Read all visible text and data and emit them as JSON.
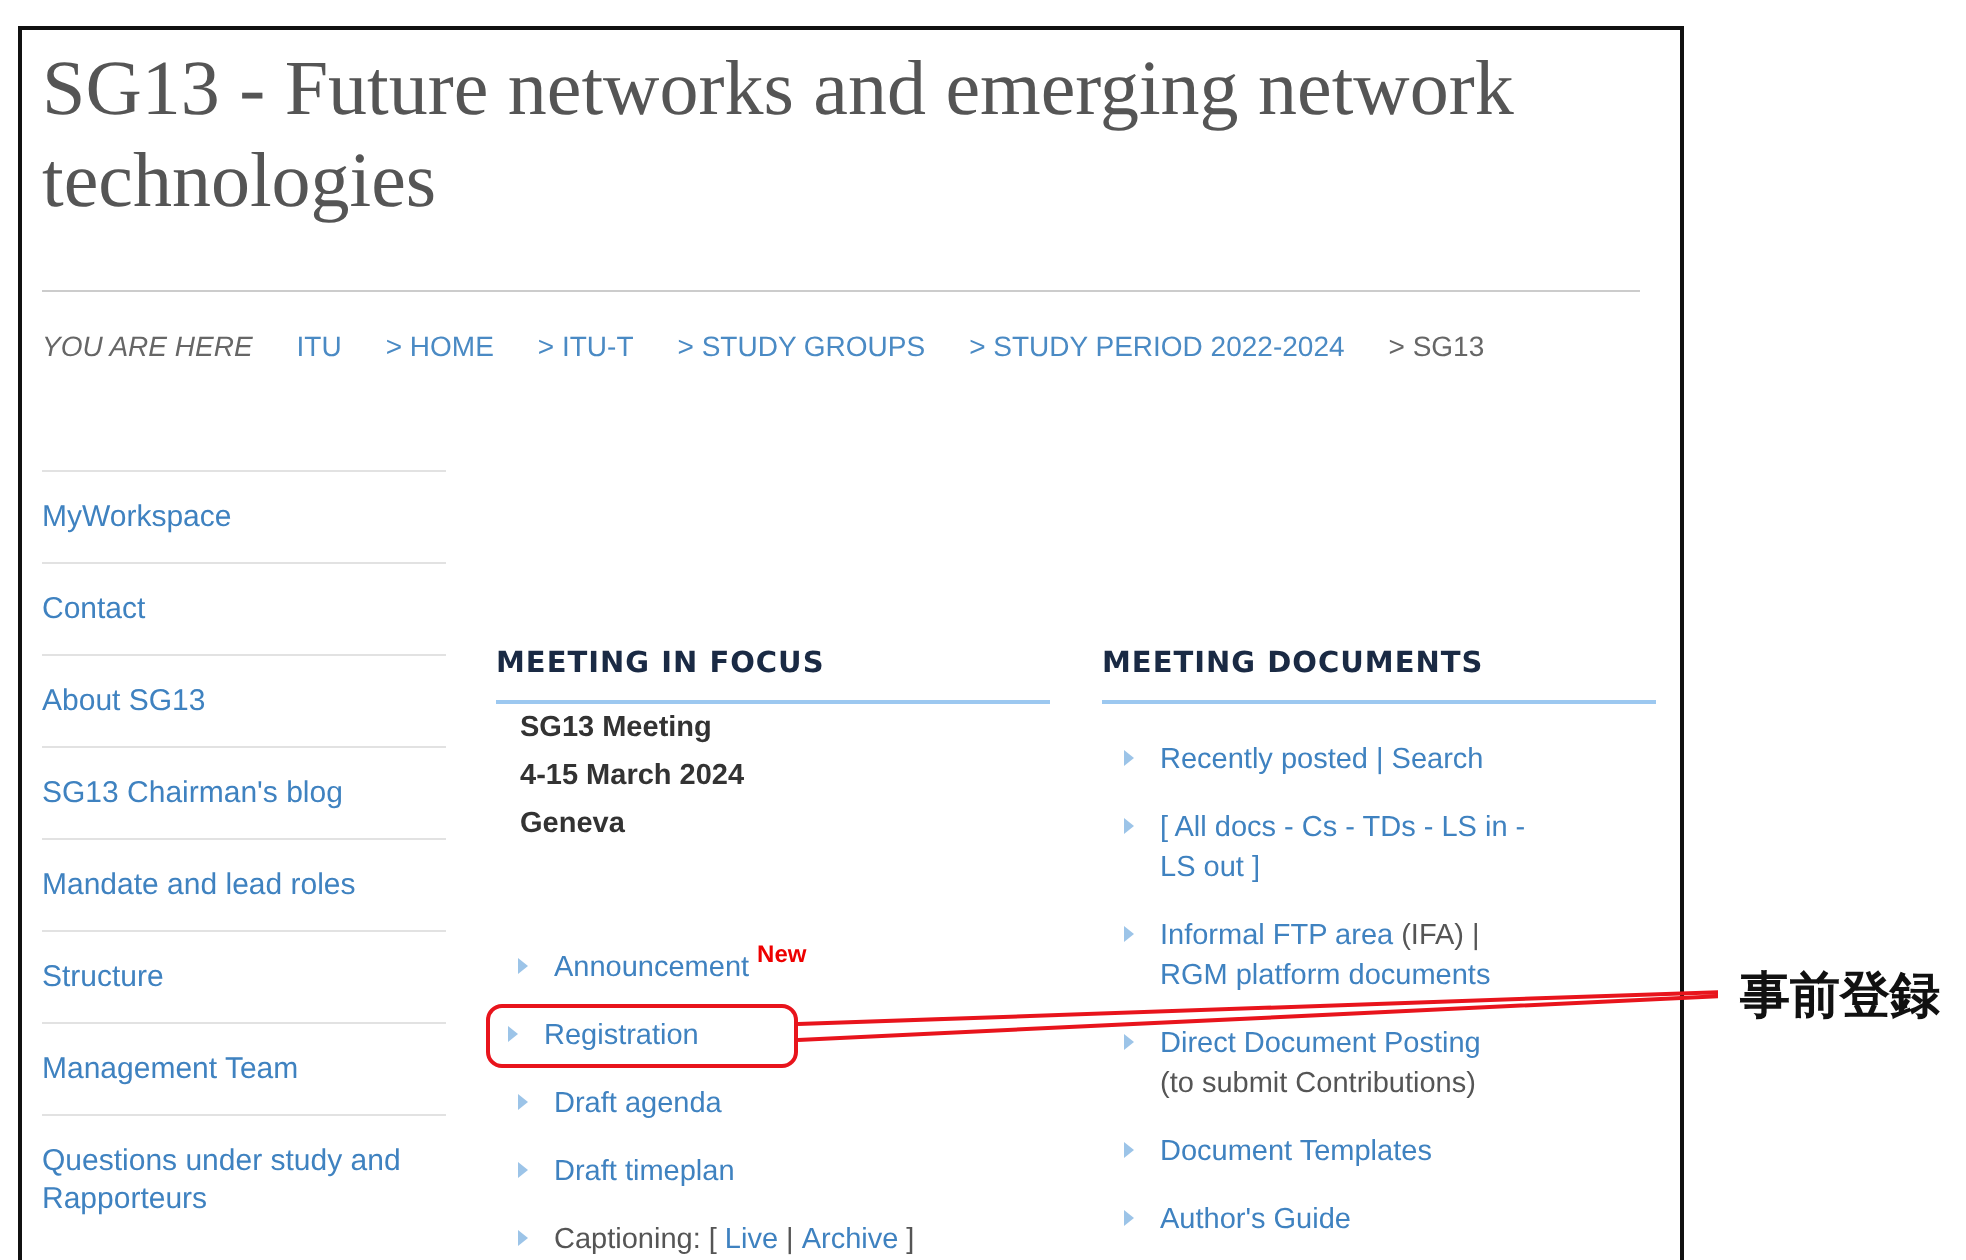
{
  "title": "SG13 - Future networks and emerging network technologies",
  "breadcrumb": {
    "label": "YOU ARE HERE",
    "items": [
      {
        "text": "ITU",
        "current": false
      },
      {
        "text": "> HOME",
        "current": false
      },
      {
        "text": "> ITU-T",
        "current": false
      },
      {
        "text": "> STUDY GROUPS",
        "current": false
      },
      {
        "text": "> STUDY PERIOD 2022-2024",
        "current": false
      },
      {
        "text": "> SG13",
        "current": true
      }
    ]
  },
  "sidebar": {
    "items": [
      "MyWorkspace",
      "Contact",
      "About SG13",
      "SG13 Chairman's blog",
      "Mandate and lead roles",
      "Structure",
      "Management Team",
      "Questions under study and Rapporteurs"
    ]
  },
  "meeting_in_focus": {
    "heading": "MEETING IN FOCUS",
    "meeting": [
      "SG13 Meeting",
      "4-15 March 2024",
      "Geneva"
    ],
    "links": [
      {
        "lines": [
          [
            {
              "text": "Announcement",
              "link": true
            }
          ]
        ],
        "badge": "New",
        "highlighted": false
      },
      {
        "lines": [
          [
            {
              "text": "Registration",
              "link": true
            }
          ]
        ],
        "highlighted": true
      },
      {
        "lines": [
          [
            {
              "text": "Draft agenda",
              "link": true
            }
          ]
        ],
        "highlighted": false
      },
      {
        "lines": [
          [
            {
              "text": "Draft timeplan",
              "link": true
            }
          ]
        ],
        "highlighted": false
      },
      {
        "lines": [
          [
            {
              "text": "Captioning: [",
              "link": false
            },
            {
              "text": "Live",
              "link": true
            },
            {
              "text": "|",
              "link": false
            },
            {
              "text": "Archive",
              "link": true
            },
            {
              "text": "]",
              "link": false
            }
          ]
        ],
        "highlighted": false
      }
    ]
  },
  "meeting_documents": {
    "heading": "MEETING DOCUMENTS",
    "links": [
      {
        "lines": [
          [
            {
              "text": "Recently posted | Search",
              "link": true
            }
          ]
        ]
      },
      {
        "lines": [
          [
            {
              "text": "[  All docs - Cs - TDs - LS in -",
              "link": true
            }
          ],
          [
            {
              "text": "LS out ]",
              "link": true
            }
          ]
        ]
      },
      {
        "lines": [
          [
            {
              "text": "Informal FTP area",
              "link": true
            },
            {
              "text": "(IFA) |",
              "link": false
            }
          ],
          [
            {
              "text": "RGM platform documents",
              "link": true
            }
          ]
        ]
      },
      {
        "lines": [
          [
            {
              "text": "Direct Document Posting",
              "link": true
            }
          ],
          [
            {
              "text": "(to submit Contributions)",
              "link": false
            }
          ]
        ]
      },
      {
        "lines": [
          [
            {
              "text": "Document Templates",
              "link": true
            }
          ]
        ]
      },
      {
        "lines": [
          [
            {
              "text": "Author's Guide",
              "link": true
            }
          ]
        ]
      }
    ]
  },
  "annotation": {
    "label": "事前登録"
  }
}
